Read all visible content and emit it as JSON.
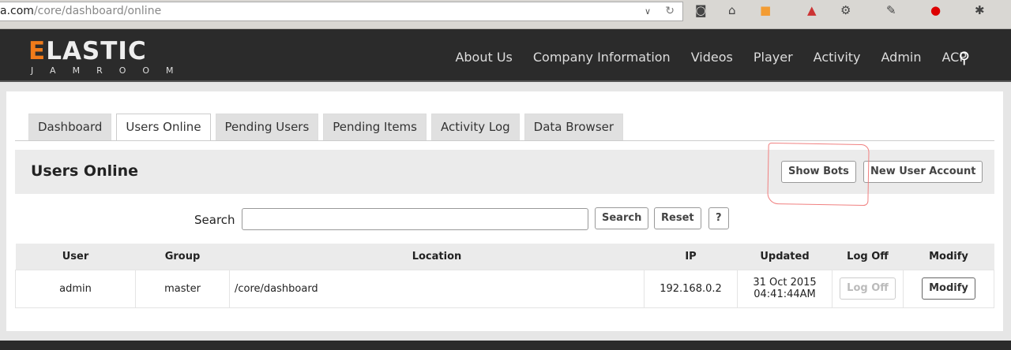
{
  "browser": {
    "url_domain": "a.com",
    "url_path": "/core/dashboard/online"
  },
  "header": {
    "logo_main": "ELASTIC",
    "logo_sub": "JAMROOM",
    "nav": [
      "About Us",
      "Company Information",
      "Videos",
      "Player",
      "Activity",
      "Admin",
      "ACP"
    ]
  },
  "tabs": [
    "Dashboard",
    "Users Online",
    "Pending Users",
    "Pending Items",
    "Activity Log",
    "Data Browser"
  ],
  "page": {
    "title": "Users Online",
    "show_bots": "Show Bots",
    "new_user": "New User Account"
  },
  "search": {
    "label": "Search",
    "value": "",
    "search_btn": "Search",
    "reset_btn": "Reset",
    "help_btn": "?"
  },
  "table": {
    "headers": [
      "User",
      "Group",
      "Location",
      "IP",
      "Updated",
      "Log Off",
      "Modify"
    ],
    "rows": [
      {
        "user": "admin",
        "group": "master",
        "location": "/core/dashboard",
        "ip": "192.168.0.2",
        "updated_date": "31 Oct 2015",
        "updated_time": "04:41:44AM",
        "logoff": "Log Off",
        "modify": "Modify"
      }
    ]
  }
}
